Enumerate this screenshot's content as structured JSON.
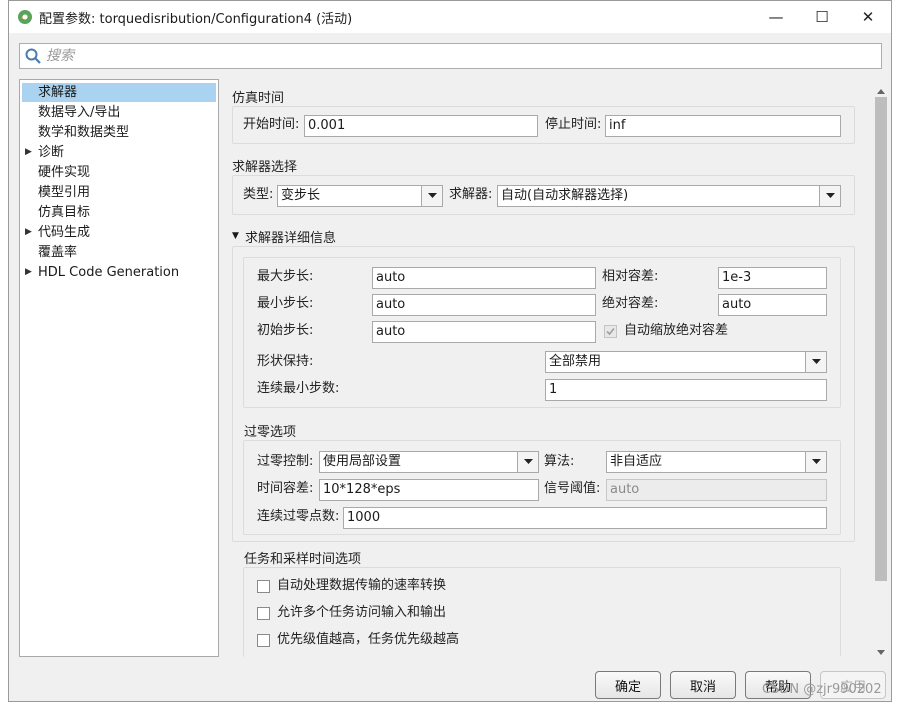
{
  "window": {
    "title": "配置参数: torquedisribution/Configuration4 (活动)",
    "minimize": "—",
    "maximize": "☐",
    "close": "✕"
  },
  "search": {
    "placeholder": "搜索"
  },
  "tree": {
    "items": [
      {
        "label": "求解器",
        "selected": true,
        "expandable": false
      },
      {
        "label": "数据导入/导出",
        "selected": false,
        "expandable": false
      },
      {
        "label": "数学和数据类型",
        "selected": false,
        "expandable": false
      },
      {
        "label": "诊断",
        "selected": false,
        "expandable": true
      },
      {
        "label": "硬件实现",
        "selected": false,
        "expandable": false
      },
      {
        "label": "模型引用",
        "selected": false,
        "expandable": false
      },
      {
        "label": "仿真目标",
        "selected": false,
        "expandable": false
      },
      {
        "label": "代码生成",
        "selected": false,
        "expandable": true
      },
      {
        "label": "覆盖率",
        "selected": false,
        "expandable": false
      },
      {
        "label": "HDL Code Generation",
        "selected": false,
        "expandable": true
      }
    ]
  },
  "sim_time": {
    "section": "仿真时间",
    "start_label": "开始时间:",
    "start_value": "0.001",
    "stop_label": "停止时间:",
    "stop_value": "inf"
  },
  "solver_select": {
    "section": "求解器选择",
    "type_label": "类型:",
    "type_value": "变步长",
    "solver_label": "求解器:",
    "solver_value": "自动(自动求解器选择)"
  },
  "solver_details": {
    "section": "求解器详细信息",
    "max_step_label": "最大步长:",
    "max_step_value": "auto",
    "min_step_label": "最小步长:",
    "min_step_value": "auto",
    "init_step_label": "初始步长:",
    "init_step_value": "auto",
    "rel_tol_label": "相对容差:",
    "rel_tol_value": "1e-3",
    "abs_tol_label": "绝对容差:",
    "abs_tol_value": "auto",
    "auto_scale_label": "自动缩放绝对容差",
    "auto_scale_checked": true,
    "shape_label": "形状保持:",
    "shape_value": "全部禁用",
    "consec_min_label": "连续最小步数:",
    "consec_min_value": "1"
  },
  "zero_crossing": {
    "section": "过零选项",
    "control_label": "过零控制:",
    "control_value": "使用局部设置",
    "algo_label": "算法:",
    "algo_value": "非自适应",
    "time_tol_label": "时间容差:",
    "time_tol_value": "10*128*eps",
    "signal_thresh_label": "信号阈值:",
    "signal_thresh_value": "auto",
    "consec_zc_label": "连续过零点数:",
    "consec_zc_value": "1000"
  },
  "tasks": {
    "section": "任务和采样时间选项",
    "opt1": "自动处理数据传输的速率转换",
    "opt2": "允许多个任务访问输入和输出",
    "opt3": "优先级值越高，任务优先级越高"
  },
  "buttons": {
    "ok": "确定",
    "cancel": "取消",
    "help": "帮助",
    "apply": "应用"
  },
  "watermark": "CSDN @zjr990202"
}
